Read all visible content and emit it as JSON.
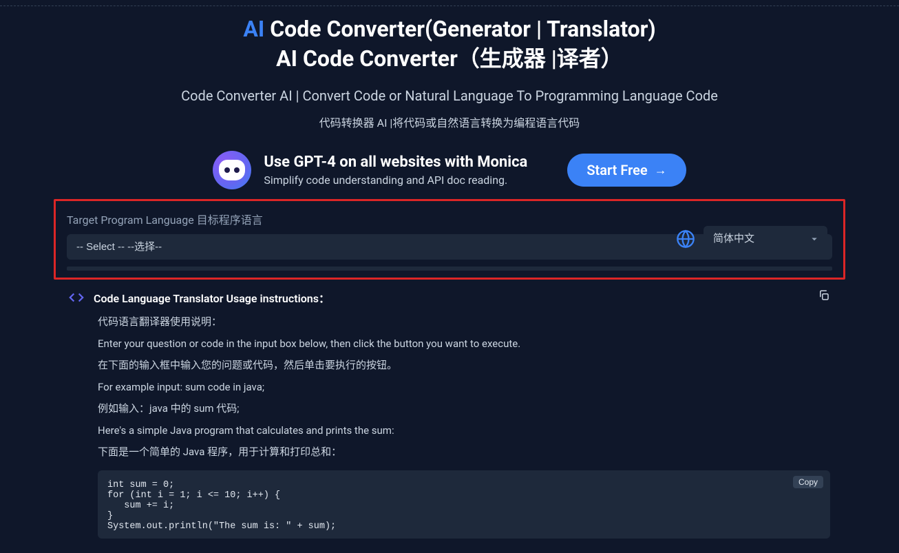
{
  "hero": {
    "ai": "AI",
    "title_rest_1": " Code Converter(Generator | Translator)",
    "title_line2": "AI Code Converter（生成器 |译者）",
    "subtitle1": "Code Converter AI | Convert Code or Natural Language To Programming Language Code",
    "subtitle2": "代码转换器 AI |将代码或自然语言转换为编程语言代码"
  },
  "promo": {
    "headline": "Use GPT-4 on all websites with Monica",
    "subline": "Simplify code understanding and API doc reading.",
    "cta": "Start Free"
  },
  "target": {
    "label": "Target Program Language 目标程序语言",
    "placeholder": "-- Select -- --选择--"
  },
  "language": {
    "selected": "简体中文"
  },
  "instructions": {
    "header": "Code Language Translator Usage instructions：",
    "lines": [
      "代码语言翻译器使用说明：",
      "Enter your question or code in the input box below, then click the button you want to execute.",
      "在下面的输入框中输入您的问题或代码，然后单击要执行的按钮。",
      "For example input: sum code in java;",
      "例如输入：java 中的 sum 代码;",
      "Here's a simple Java program that calculates and prints the sum:",
      "下面是一个简单的 Java 程序，用于计算和打印总和："
    ],
    "copy_label": "Copy"
  },
  "code": "int sum = 0;\nfor (int i = 1; i <= 10; i++) {\n   sum += i;\n}\nSystem.out.println(\"The sum is: \" + sum);"
}
